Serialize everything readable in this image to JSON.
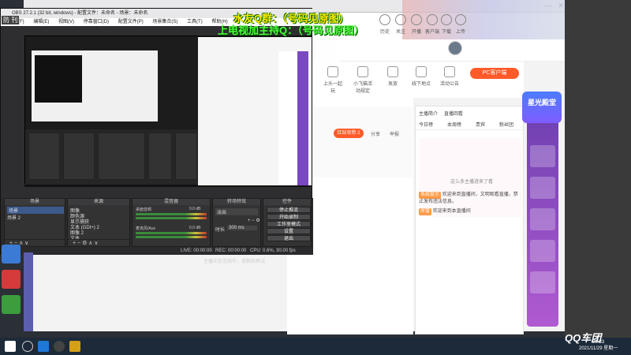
{
  "overlay": {
    "qq_text": "水友Q群：（号码见原图）",
    "host_text": "上电视加主持Q：（号码见原图）"
  },
  "browser": {
    "left_label": "防 刊",
    "window_minimize": "—",
    "window_close": "✕",
    "header_icons": [
      "历史",
      "关注",
      "开播",
      "客户端",
      "下载",
      "上传"
    ],
    "sub_icons": [
      "上头一起玩",
      "小飞猫活动规定",
      "发放",
      "线下地点",
      "活动公告"
    ],
    "pc_client": "PC客户端",
    "gift_button": "红钻攻势 2",
    "share": "分享",
    "report": "举报",
    "star_banner": "星光殿堂",
    "chat_tabs": [
      "主播简介",
      "直播回看",
      "今日榜",
      "本周榜",
      "贵宾",
      "粉丝团"
    ],
    "chat_hero_caption": "这么多主播进来了看",
    "chat_messages": [
      {
        "tag": "系统提示",
        "text": "欢迎来到直播间，文明观看直播，禁止发布违法信息。"
      },
      {
        "tag": "房管",
        "text": "欢迎来到本直播间"
      }
    ]
  },
  "obs": {
    "title": "OBS 27.2.1 (32 bit, windows) - 配置文件：未命名 - 场景：未命名",
    "menu": [
      "文件(F)",
      "编辑(E)",
      "视图(V)",
      "停靠窗口(D)",
      "配置文件(P)",
      "场景集合(S)",
      "工具(T)",
      "帮助(H)"
    ],
    "docks": {
      "scenes": {
        "title": "场景",
        "items": [
          "场景",
          "场景 2"
        ]
      },
      "sources": {
        "title": "来源",
        "items": [
          "图像",
          "颜色源",
          "显示捕获",
          "文本 (GDI+) 2",
          "图像 2",
          "文本"
        ]
      },
      "mixer": {
        "title": "混音器",
        "channels": [
          {
            "name": "桌面音频",
            "level": "0.0 dB"
          },
          {
            "name": "麦克风/Aux",
            "level": "0.0 dB"
          }
        ]
      },
      "transitions": {
        "title": "转场特效",
        "effect": "淡出",
        "duration_label": "时长",
        "duration": "300 ms"
      },
      "controls": {
        "title": "控件",
        "buttons": [
          "停止推流",
          "开始录制",
          "工作室模式",
          "设置",
          "退出"
        ]
      }
    },
    "status": {
      "live": "LIVE: 00:00:00",
      "rec": "REC: 00:00:00",
      "cpu": "CPU: 0.6%, 30.00 fps"
    },
    "bottom_note": "主播正在连线中，请稍后再试"
  },
  "taskbar": {
    "time": "20:33",
    "date": "2021/11/29 星期一",
    "watermark": "QQ车团"
  }
}
